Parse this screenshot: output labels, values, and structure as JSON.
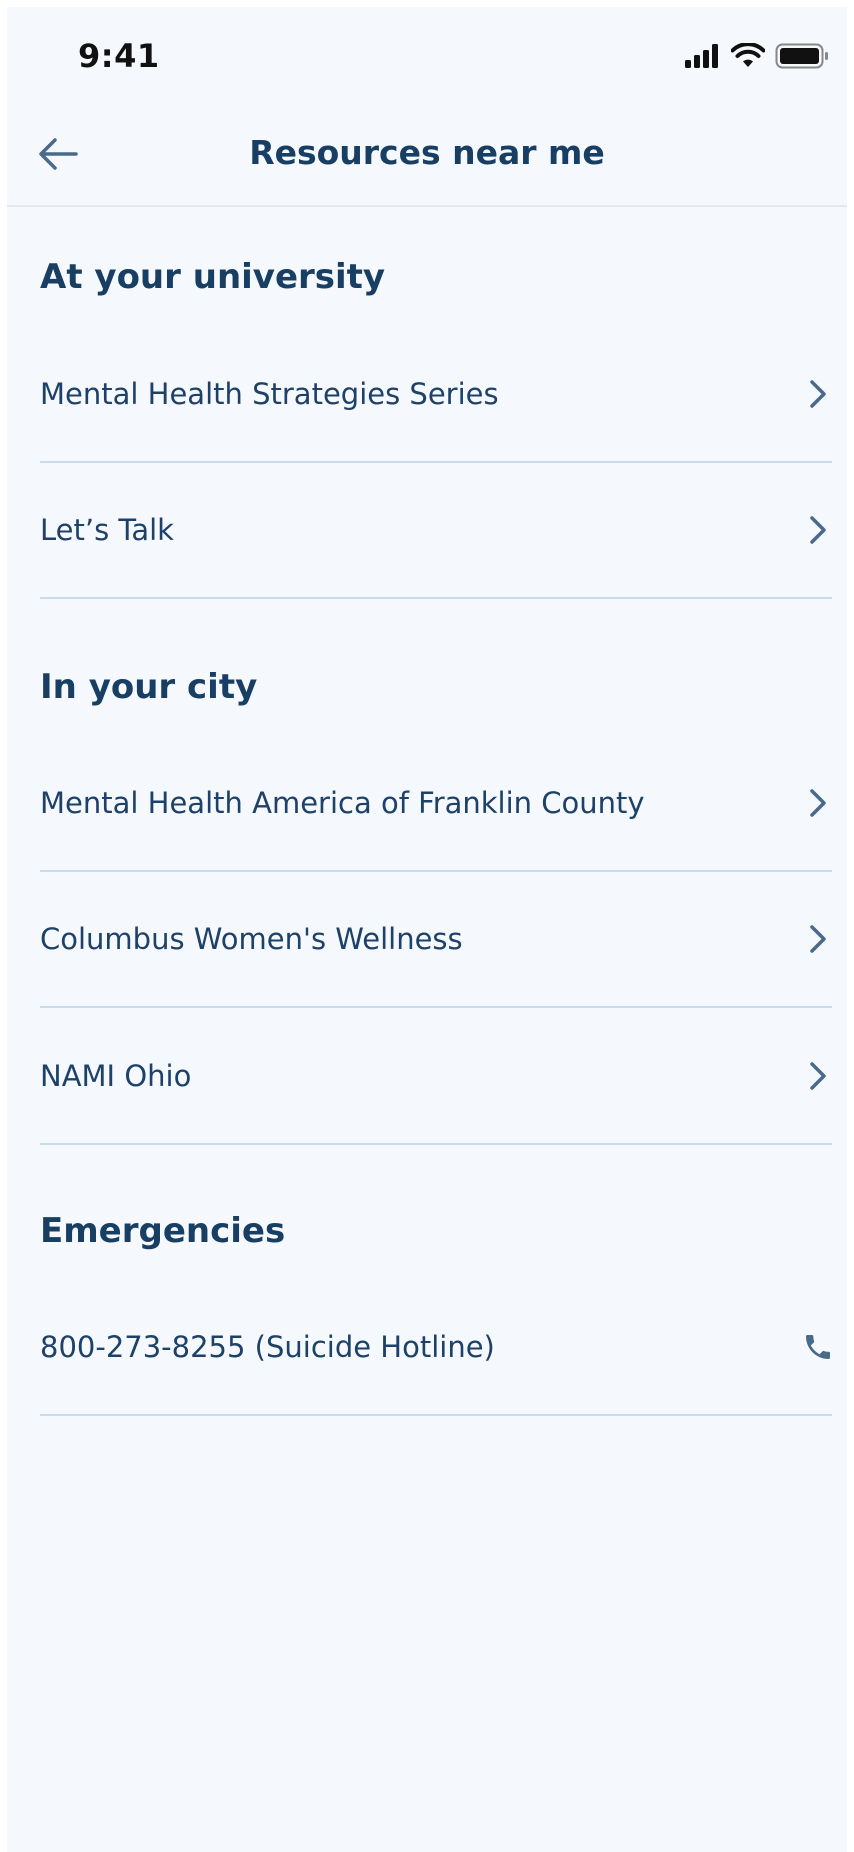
{
  "status_bar": {
    "time": "9:41"
  },
  "nav": {
    "title": "Resources near me",
    "back_icon": "arrow-left-icon"
  },
  "sections": [
    {
      "heading": "At your university",
      "items": [
        {
          "label": "Mental Health Strategies Series",
          "icon": "chevron-right-icon"
        },
        {
          "label": "Let’s Talk",
          "icon": "chevron-right-icon"
        }
      ]
    },
    {
      "heading": "In your city",
      "items": [
        {
          "label": "Mental Health America of Franklin County",
          "icon": "chevron-right-icon"
        },
        {
          "label": "Columbus Women's Wellness",
          "icon": "chevron-right-icon"
        },
        {
          "label": "NAMI Ohio",
          "icon": "chevron-right-icon"
        }
      ]
    },
    {
      "heading": "Emergencies",
      "items": [
        {
          "label": "800-273-8255 (Suicide Hotline)",
          "icon": "phone-icon"
        }
      ]
    }
  ],
  "colors": {
    "background": "#f5f8fc",
    "primary_text": "#183f63",
    "icon": "#4a6a8a",
    "divider": "#c8dcec"
  }
}
